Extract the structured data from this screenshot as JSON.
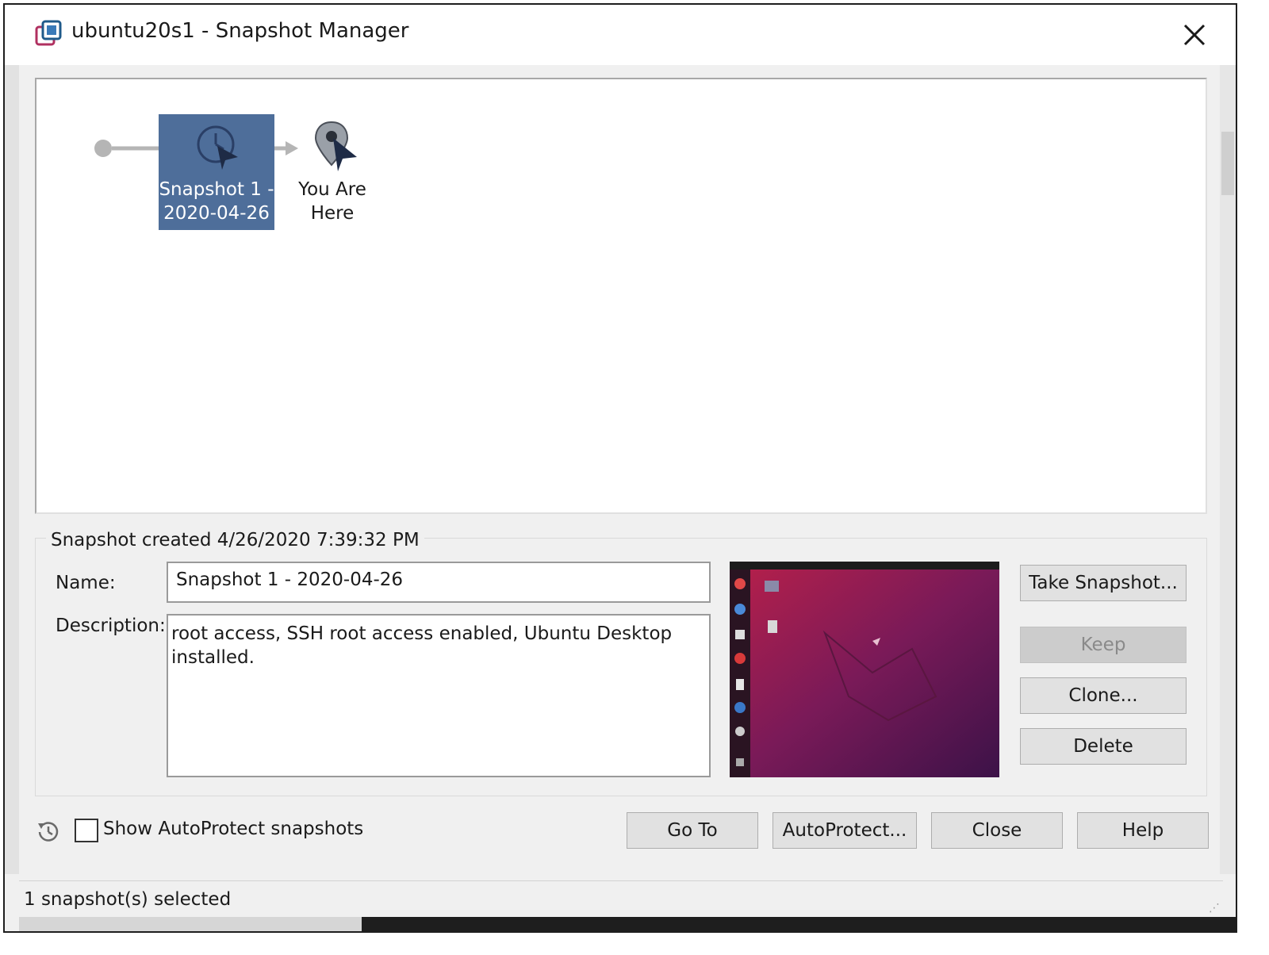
{
  "window": {
    "title": "ubuntu20s1 - Snapshot Manager",
    "icons": [
      "snapshot-manager-icon",
      "close-icon"
    ]
  },
  "tree": {
    "snapshot": {
      "label": "Snapshot 1 -\n2020-04-26",
      "icon": "clock-icon",
      "color": "#4e6e9a"
    },
    "current": {
      "label": "You Are\nHere",
      "icon": "location-pin-icon"
    }
  },
  "details": {
    "created_text": "Snapshot created 4/26/2020 7:39:32 PM",
    "name_label": "Name:",
    "name_value": "Snapshot 1 - 2020-04-26",
    "description_label": "Description:",
    "description_value": "root access, SSH root access enabled, Ubuntu Desktop installed.",
    "thumbnail": "ubuntu-desktop-screenshot"
  },
  "side_buttons": {
    "take_snapshot": "Take Snapshot...",
    "keep": "Keep",
    "clone": "Clone...",
    "delete": "Delete"
  },
  "footer": {
    "autoprotect_checkbox_label": "Show AutoProtect snapshots",
    "autoprotect_checked": false,
    "go_to": "Go To",
    "autoprotect": "AutoProtect...",
    "close": "Close",
    "help": "Help"
  },
  "status": {
    "text": "1 snapshot(s) selected"
  }
}
